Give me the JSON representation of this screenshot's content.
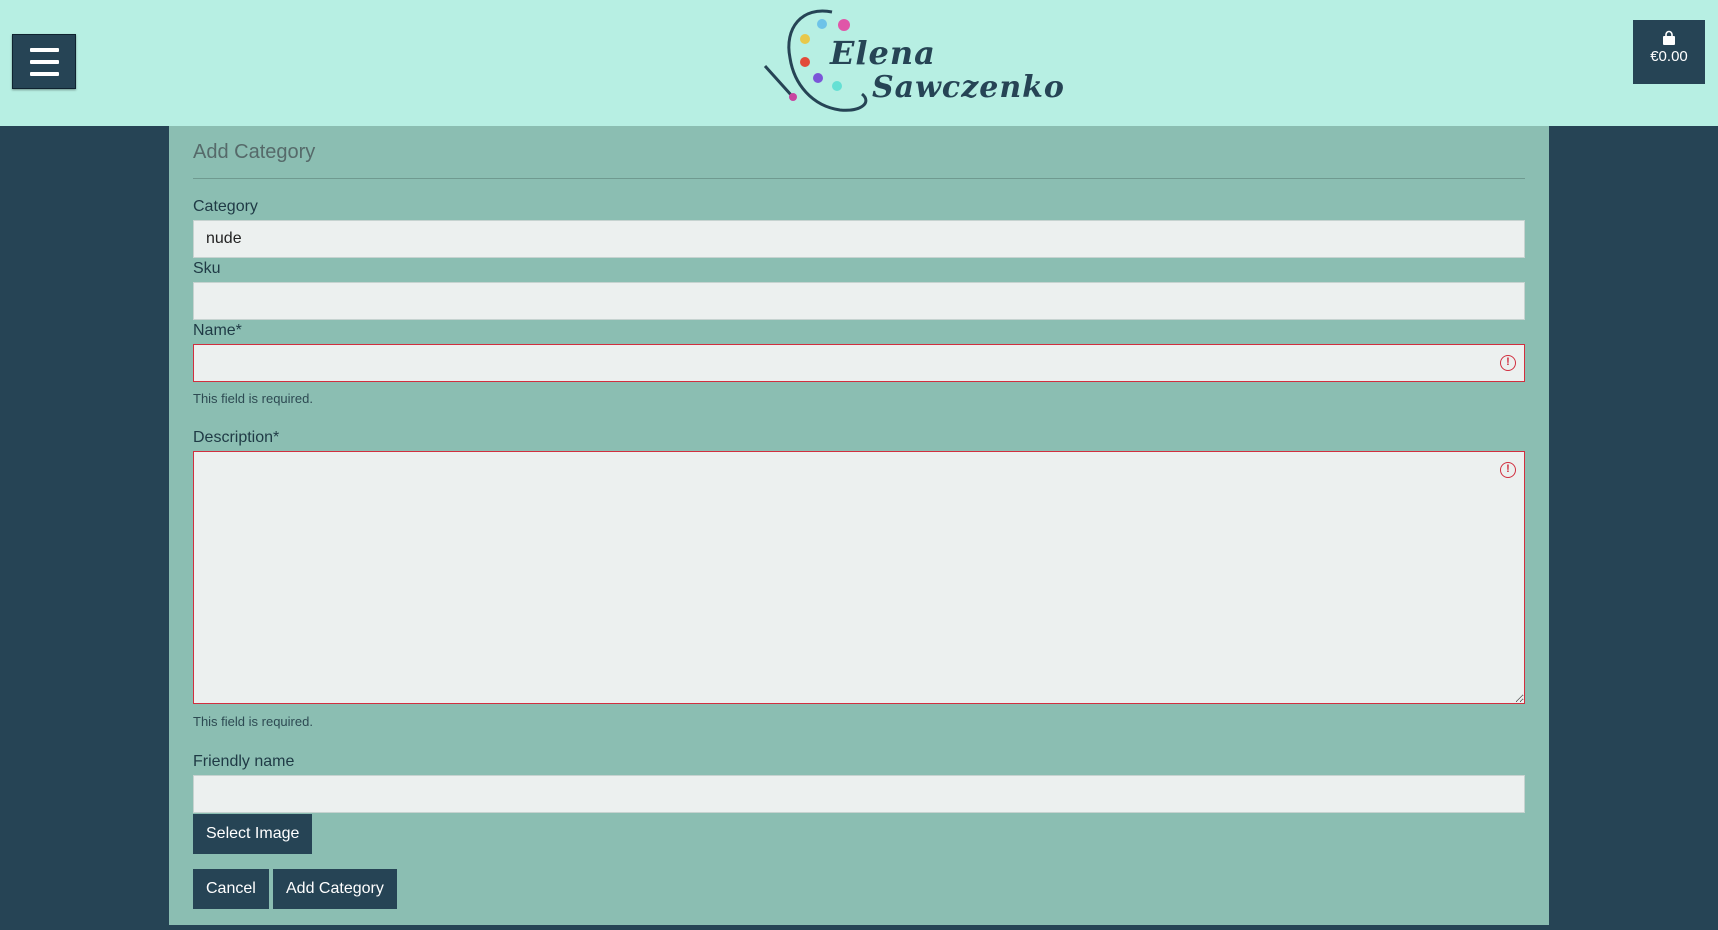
{
  "header": {
    "logo_line1": "Elena",
    "logo_line2": "Sawczenko",
    "cart_total": "€0.00"
  },
  "form": {
    "title": "Add Category",
    "category_label": "Category",
    "category_value": "nude",
    "sku_label": "Sku",
    "sku_value": "",
    "name_label": "Name*",
    "name_value": "",
    "name_error": "This field is required.",
    "description_label": "Description*",
    "description_value": "",
    "description_error": "This field is required.",
    "friendly_name_label": "Friendly name",
    "friendly_name_value": "",
    "select_image_label": "Select Image",
    "cancel_label": "Cancel",
    "submit_label": "Add Category"
  },
  "icons": {
    "menu": "hamburger-menu-icon",
    "cart": "shopping-bag-icon",
    "error": "exclamation-circle-icon"
  },
  "colors": {
    "header_bg": "#b7efe3",
    "page_bg": "#264455",
    "panel_bg": "#8bbeb2",
    "error": "#d12f3f"
  }
}
